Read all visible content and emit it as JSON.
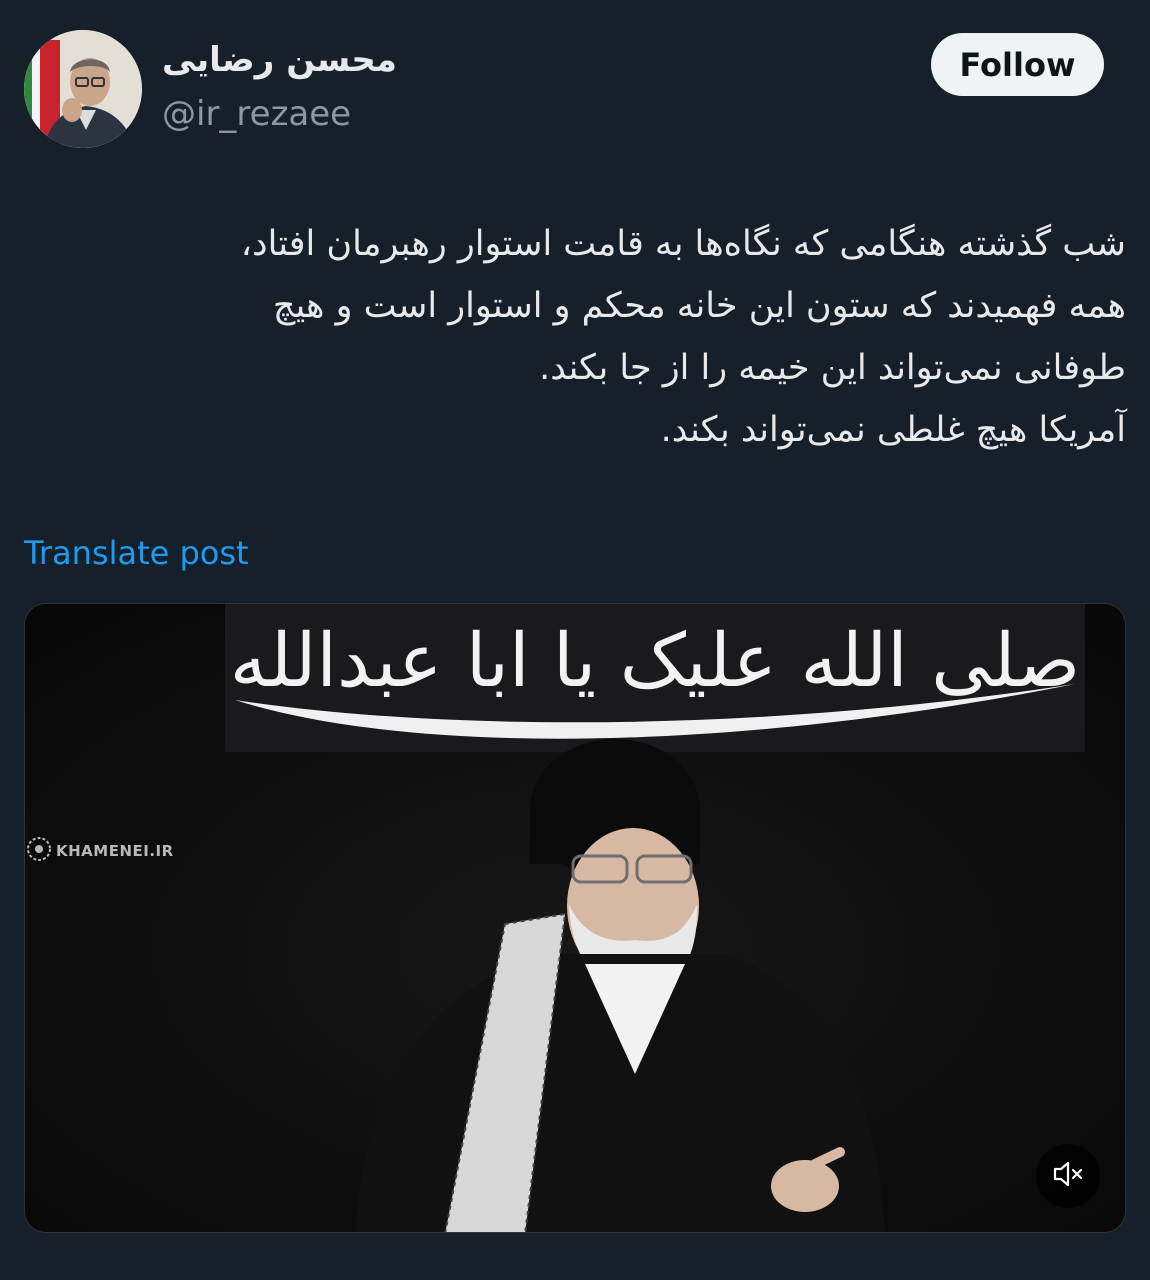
{
  "author": {
    "display_name": "محسن رضایی",
    "handle": "@ir_rezaee",
    "avatar_icon": "profile-photo"
  },
  "actions": {
    "follow_label": "Follow",
    "translate_label": "Translate post"
  },
  "post": {
    "lines": [
      "شب گذشته هنگامی که نگاه‌ها به قامت استوار رهبرمان افتاد،",
      "همه فهمیدند که ستون این خانه محکم و استوار است و هیچ",
      "طوفانی نمی‌تواند این خیمه را از جا بکند.",
      "آمریکا هیچ غلطی نمی‌تواند بکند."
    ]
  },
  "media": {
    "banner_text": "صلی الله علیک یا ابا عبدالله",
    "watermark": "KHAMENEI.IR",
    "mute_icon": "speaker-muted-icon"
  },
  "colors": {
    "background": "#15202b",
    "text": "#e7e9ea",
    "muted_text": "#8b98a5",
    "link": "#1d9bf0",
    "follow_bg": "#eff3f4"
  }
}
